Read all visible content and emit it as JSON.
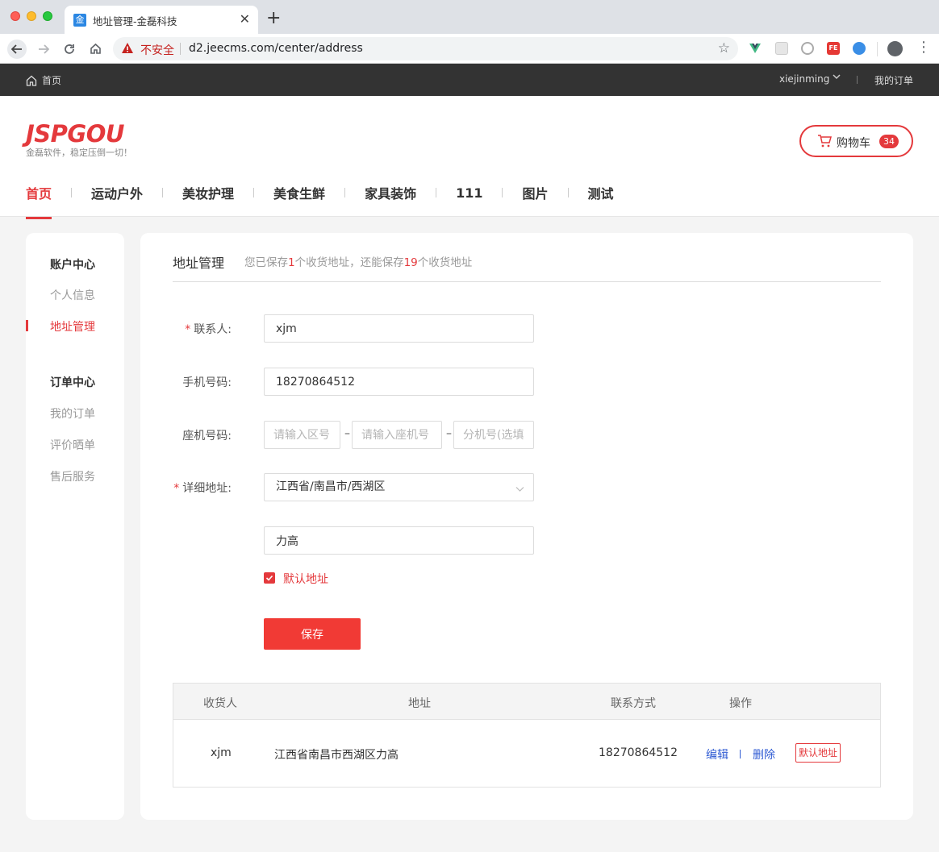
{
  "browser": {
    "tab_title": "地址管理-金磊科技",
    "tab_favicon": "金",
    "close_glyph": "✕",
    "newtab_glyph": "+",
    "not_secure": "不安全",
    "url": "d2.jeecms.com/center/address",
    "ext_fe": "FE"
  },
  "topbar": {
    "home": "首页",
    "user": "xiejinming",
    "my_orders": "我的订单"
  },
  "header": {
    "logo": "JSPGOU",
    "slogan": "金磊软件，稳定压倒一切！",
    "cart_label": "购物车",
    "cart_count": "34"
  },
  "nav": {
    "items": [
      "首页",
      "运动户外",
      "美妆护理",
      "美食生鲜",
      "家具装饰",
      "111",
      "图片",
      "测试"
    ],
    "active_index": 0
  },
  "sidebar": {
    "group1": "账户中心",
    "profile": "个人信息",
    "address": "地址管理",
    "group2": "订单中心",
    "my_orders": "我的订单",
    "reviews": "评价晒单",
    "after_sales": "售后服务"
  },
  "panel": {
    "title": "地址管理",
    "info_prefix": "您已保存",
    "saved_count": "1",
    "info_middle": "个收货地址，还能保存",
    "remaining_count": "19",
    "info_suffix": "个收货地址"
  },
  "form": {
    "required_mark": "*",
    "contact_label": "联系人:",
    "contact_value": "xjm",
    "phone_label": "手机号码:",
    "phone_value": "18270864512",
    "landline_label": "座机号码:",
    "area_placeholder": "请输入区号",
    "landline_placeholder": "请输入座机号",
    "ext_placeholder": "分机号(选填)",
    "dash": "–",
    "address_label": "详细地址:",
    "region_value": "江西省/南昌市/西湖区",
    "street_value": "力高",
    "default_checked": true,
    "default_label": "默认地址",
    "save_label": "保存"
  },
  "table": {
    "headers": [
      "收货人",
      "地址",
      "联系方式",
      "操作"
    ],
    "rows": [
      {
        "name": "xjm",
        "address": "江西省南昌市西湖区力高",
        "contact": "18270864512",
        "edit": "编辑",
        "delete": "删除",
        "default_tag": "默认地址"
      }
    ]
  },
  "colors": {
    "brand": "#e4393c",
    "link": "#2f5bd3",
    "topbar": "#333333"
  },
  "icons": [
    "home-icon",
    "cart-icon",
    "warning-icon",
    "star-icon",
    "check-icon",
    "chevron-down-icon",
    "profile-icon",
    "kebab-menu-icon"
  ]
}
